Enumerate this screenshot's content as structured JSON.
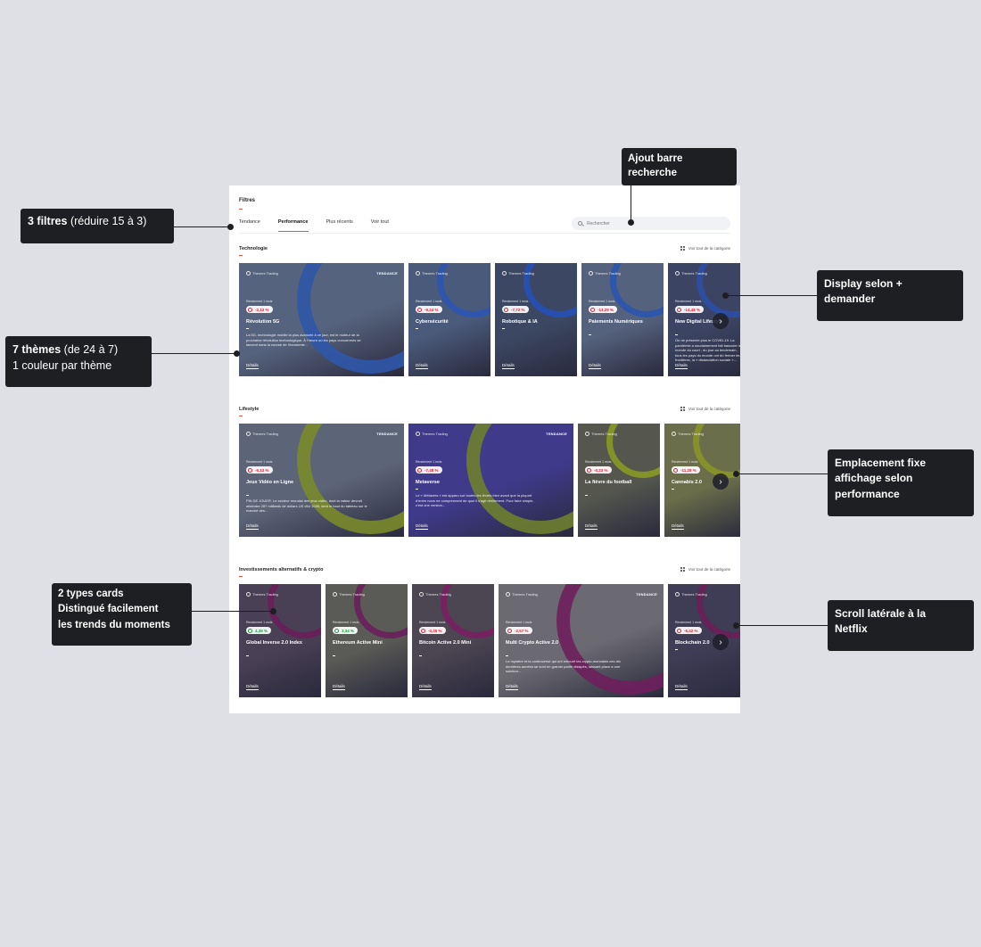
{
  "filters": {
    "title": "Filtres",
    "tabs": [
      {
        "label": "Tendance",
        "active": false
      },
      {
        "label": "Performance",
        "active": true
      },
      {
        "label": "Plus récents",
        "active": false
      },
      {
        "label": "Voir tout",
        "active": false
      }
    ],
    "search_placeholder": "Rechercher"
  },
  "see_all_label": "Voir tout de la catégorie",
  "sections": [
    {
      "title": "Technologie",
      "cards": [
        {
          "brand": "Themes Trading",
          "trend": "TENDANCE",
          "perf_label": "Rendement 1 mois",
          "perf": "-2,13 %",
          "perf_sign": "neg",
          "name": "Révolution 5G",
          "desc": "La 5G, technologie mobile la plus avancée à ce jour, est le moteur de la prochaine révolution technologique. À l'heure où les pays concurrents se lancent dans la course de l'économie...",
          "details": "Détails",
          "color": "#56637e",
          "deco": "#2f56a8"
        },
        {
          "brand": "Themes Trading",
          "trend": "",
          "perf_label": "Rendement 1 mois",
          "perf": "-9,34 %",
          "perf_sign": "neg",
          "name": "Cybersécurité",
          "desc": "",
          "details": "Détails",
          "color": "#4a5a7a",
          "deco": "#2c54b3"
        },
        {
          "brand": "Themes Trading",
          "trend": "",
          "perf_label": "Rendement 1 mois",
          "perf": "-7,72 %",
          "perf_sign": "neg",
          "name": "Robotique & IA",
          "desc": "",
          "details": "Détails",
          "color": "#3c4863",
          "deco": "#2450b8"
        },
        {
          "brand": "Themes Trading",
          "trend": "",
          "perf_label": "Rendement 1 mois",
          "perf": "-13,29 %",
          "perf_sign": "neg",
          "name": "Paiements Numériques",
          "desc": "",
          "details": "Détails",
          "color": "#55627d",
          "deco": "#2a55b0"
        },
        {
          "brand": "Themes Trading",
          "trend": "",
          "perf_label": "Rendement 1 mois",
          "perf": "-14,48 %",
          "perf_sign": "neg",
          "name": "New Digital Lifestyle",
          "desc": "On ne présente plus le COVID-19. La pandémie a soudainement fait basculer le monde du court ; du jour au lendemain, tous les pays du monde ont dû fermer leurs frontières, la « distanciation sociale »...",
          "details": "Détails",
          "color": "#3b4462",
          "deco": "#2c4fa6"
        }
      ]
    },
    {
      "title": "Lifestyle",
      "cards": [
        {
          "brand": "Themes Trading",
          "trend": "TENDANCE",
          "perf_label": "Rendement 1 mois",
          "perf": "-6,13 %",
          "perf_sign": "neg",
          "name": "Jeux Vidéo en Ligne",
          "desc": "FIN DE JOUER. Le secteur mondial des jeux vidéo, dont la valeur devrait atteindre 287 milliards de dollars US d'ici 2026, tient le haut du tableau sur le marché des...",
          "details": "Détails",
          "color": "#5c6478",
          "deco": "#7a8a2a"
        },
        {
          "brand": "Themes Trading",
          "trend": "TENDANCE",
          "perf_label": "Rendement 1 mois",
          "perf": "-7,48 %",
          "perf_sign": "neg",
          "name": "Metaverse",
          "desc": "Le « Métavers » est apparu sur toutes les lèvres bien avant que la plupart d'entre nous ne comprennent de quoi il s'agit réellement. Pour faire simple, c'est une version...",
          "details": "Détails",
          "color": "#3f3a8a",
          "deco": "#6e7f2e"
        },
        {
          "brand": "Themes Trading",
          "trend": "",
          "perf_label": "Rendement 1 mois",
          "perf": "-0,23 %",
          "perf_sign": "neg",
          "name": "La fièvre du football",
          "desc": "",
          "details": "Détails",
          "color": "#55574f",
          "deco": "#8a9a22"
        },
        {
          "brand": "Themes Trading",
          "trend": "",
          "perf_label": "Rendement 1 mois",
          "perf": "-11,28 %",
          "perf_sign": "neg",
          "name": "Cannabis 2.0",
          "desc": "",
          "details": "Détails",
          "color": "#6a6e4a",
          "deco": "#8a9528"
        }
      ]
    },
    {
      "title": "Investissements alternatifs & crypto",
      "cards": [
        {
          "brand": "Themes Trading",
          "trend": "",
          "perf_label": "Rendement 1 mois",
          "perf": "4,35 %",
          "perf_sign": "pos",
          "name": "Global Inverse 2.0 Index",
          "desc": "",
          "details": "Détails",
          "color": "#4a4055",
          "deco": "#6a1e5a"
        },
        {
          "brand": "Themes Trading",
          "trend": "",
          "perf_label": "Rendement 1 mois",
          "perf": "3,34 %",
          "perf_sign": "pos",
          "name": "Ethereum Active Mini",
          "desc": "",
          "details": "Détails",
          "color": "#5a5a56",
          "deco": "#6a1e5c"
        },
        {
          "brand": "Themes Trading",
          "trend": "",
          "perf_label": "Rendement 1 mois",
          "perf": "-0,35 %",
          "perf_sign": "neg",
          "name": "Bitcoin Active 2.0 Mini",
          "desc": "",
          "details": "Détails",
          "color": "#4c4552",
          "deco": "#7a1f62"
        },
        {
          "brand": "Themes Trading",
          "trend": "TENDANCE",
          "perf_label": "Rendement 1 mois",
          "perf": "-2,57 %",
          "perf_sign": "neg",
          "name": "Multi Crypto Active 2.0",
          "desc": "Le mystère et la controverse qui ont entouré les crypto-monnaies ces dix dernières années se sont en grande partie dissipés, laissant place à une solution...",
          "details": "Détails",
          "color": "#6b6a72",
          "deco": "#6e1f5c"
        },
        {
          "brand": "Themes Trading",
          "trend": "",
          "perf_label": "Rendement 1 mois",
          "perf": "-6,42 %",
          "perf_sign": "neg",
          "name": "Blockchain 2.0",
          "desc": "",
          "details": "Détails",
          "color": "#3f3c55",
          "deco": "#6a1e58"
        }
      ]
    }
  ],
  "annotations": {
    "search": {
      "line1": "Ajout barre",
      "line2": "recherche"
    },
    "filters": {
      "bold": "3 filtres",
      "rest": " (réduire 15 à 3)"
    },
    "themes": {
      "bold": "7 thèmes",
      "rest": " (de 24 à 7)",
      "line2": "1 couleur par thème"
    },
    "cards": {
      "line1": "2 types cards",
      "line2": "Distingué facilement",
      "line3": "les trends du moments"
    },
    "display": {
      "line1": "Display selon +",
      "line2": "demander"
    },
    "placement": {
      "line1": "Emplacement fixe",
      "line2": "affichage selon",
      "line3": "performance"
    },
    "scroll": {
      "line1": "Scroll latérale à la",
      "line2": "Netflix"
    }
  },
  "colors": {
    "accent": "#e0533d",
    "negative": "#e0253b",
    "positive": "#19a244",
    "annotation_bg": "#1e1f22",
    "background": "#dfe0e5"
  }
}
